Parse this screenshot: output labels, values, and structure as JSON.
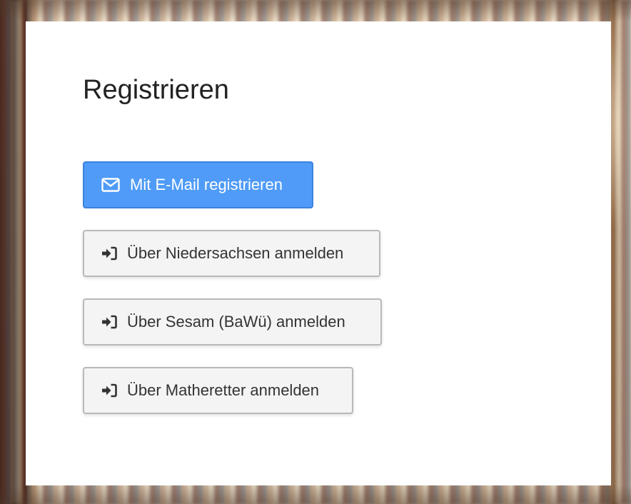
{
  "page": {
    "title": "Registrieren"
  },
  "buttons": {
    "email": {
      "label": "Mit E-Mail registrieren",
      "icon": "envelope-icon"
    },
    "niedersachsen": {
      "label": "Über Niedersachsen anmelden",
      "icon": "sign-in-icon"
    },
    "sesam": {
      "label": "Über Sesam (BaWü) anmelden",
      "icon": "sign-in-icon"
    },
    "matheretter": {
      "label": "Über Matheretter anmelden",
      "icon": "sign-in-icon"
    }
  },
  "colors": {
    "primary": "#4f9bf7",
    "primary_border": "#3a83dc",
    "default_bg": "#f4f4f4",
    "default_border": "#b9b9b9",
    "text": "#333333"
  }
}
